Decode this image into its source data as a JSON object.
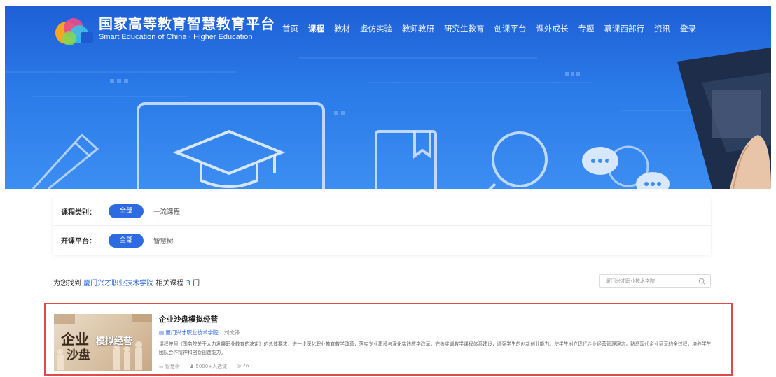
{
  "header": {
    "brand_cn": "国家高等教育智慧教育平台",
    "brand_en": "Smart Education of China · Higher Education",
    "nav": [
      {
        "label": "首页",
        "active": false
      },
      {
        "label": "课程",
        "active": true
      },
      {
        "label": "教材",
        "active": false
      },
      {
        "label": "虚仿实验",
        "active": false
      },
      {
        "label": "教师教研",
        "active": false
      },
      {
        "label": "研究生教育",
        "active": false
      },
      {
        "label": "创课平台",
        "active": false
      },
      {
        "label": "课外成长",
        "active": false
      },
      {
        "label": "专题",
        "active": false
      },
      {
        "label": "慕课西部行",
        "active": false
      },
      {
        "label": "资讯",
        "active": false
      },
      {
        "label": "登录",
        "active": false
      }
    ]
  },
  "filters": {
    "category_label": "课程类别：",
    "category_selected": "全部",
    "category_option": "一流课程",
    "platform_label": "开课平台：",
    "platform_selected": "全部",
    "platform_option": "智慧树"
  },
  "results": {
    "prefix": "为您找到",
    "school": "厦门兴才职业技术学院",
    "middle": "相关课程",
    "count": "3",
    "suffix": "门",
    "search_placeholder": "厦门兴才职业技术学院"
  },
  "course": {
    "title": "企业沙盘模拟经营",
    "school": "厦门兴才职业技术学院",
    "teacher": "刘文锋",
    "thumb_line1": "企业",
    "thumb_line2": "沙盘",
    "thumb_line3": "模拟经营",
    "description": "课程按照《国务院关于大力发展职业教育的决定》的总体要求，进一步深化职业教育教学改革，落实专业建设与深化实践教学改革，完善实训教学课程体系建设，增强学生的创新创业能力。使学生树立现代企业经营管理理念，熟悉现代企业运营的全过程，培养学生团队合作精神和创新创造能力。",
    "platform": "智慧树",
    "learners": "5000+人选课",
    "views": "26"
  },
  "colors": {
    "accent": "#2f6be0",
    "banner": "#2a7ae8",
    "highlight_border": "#e24a4a"
  }
}
